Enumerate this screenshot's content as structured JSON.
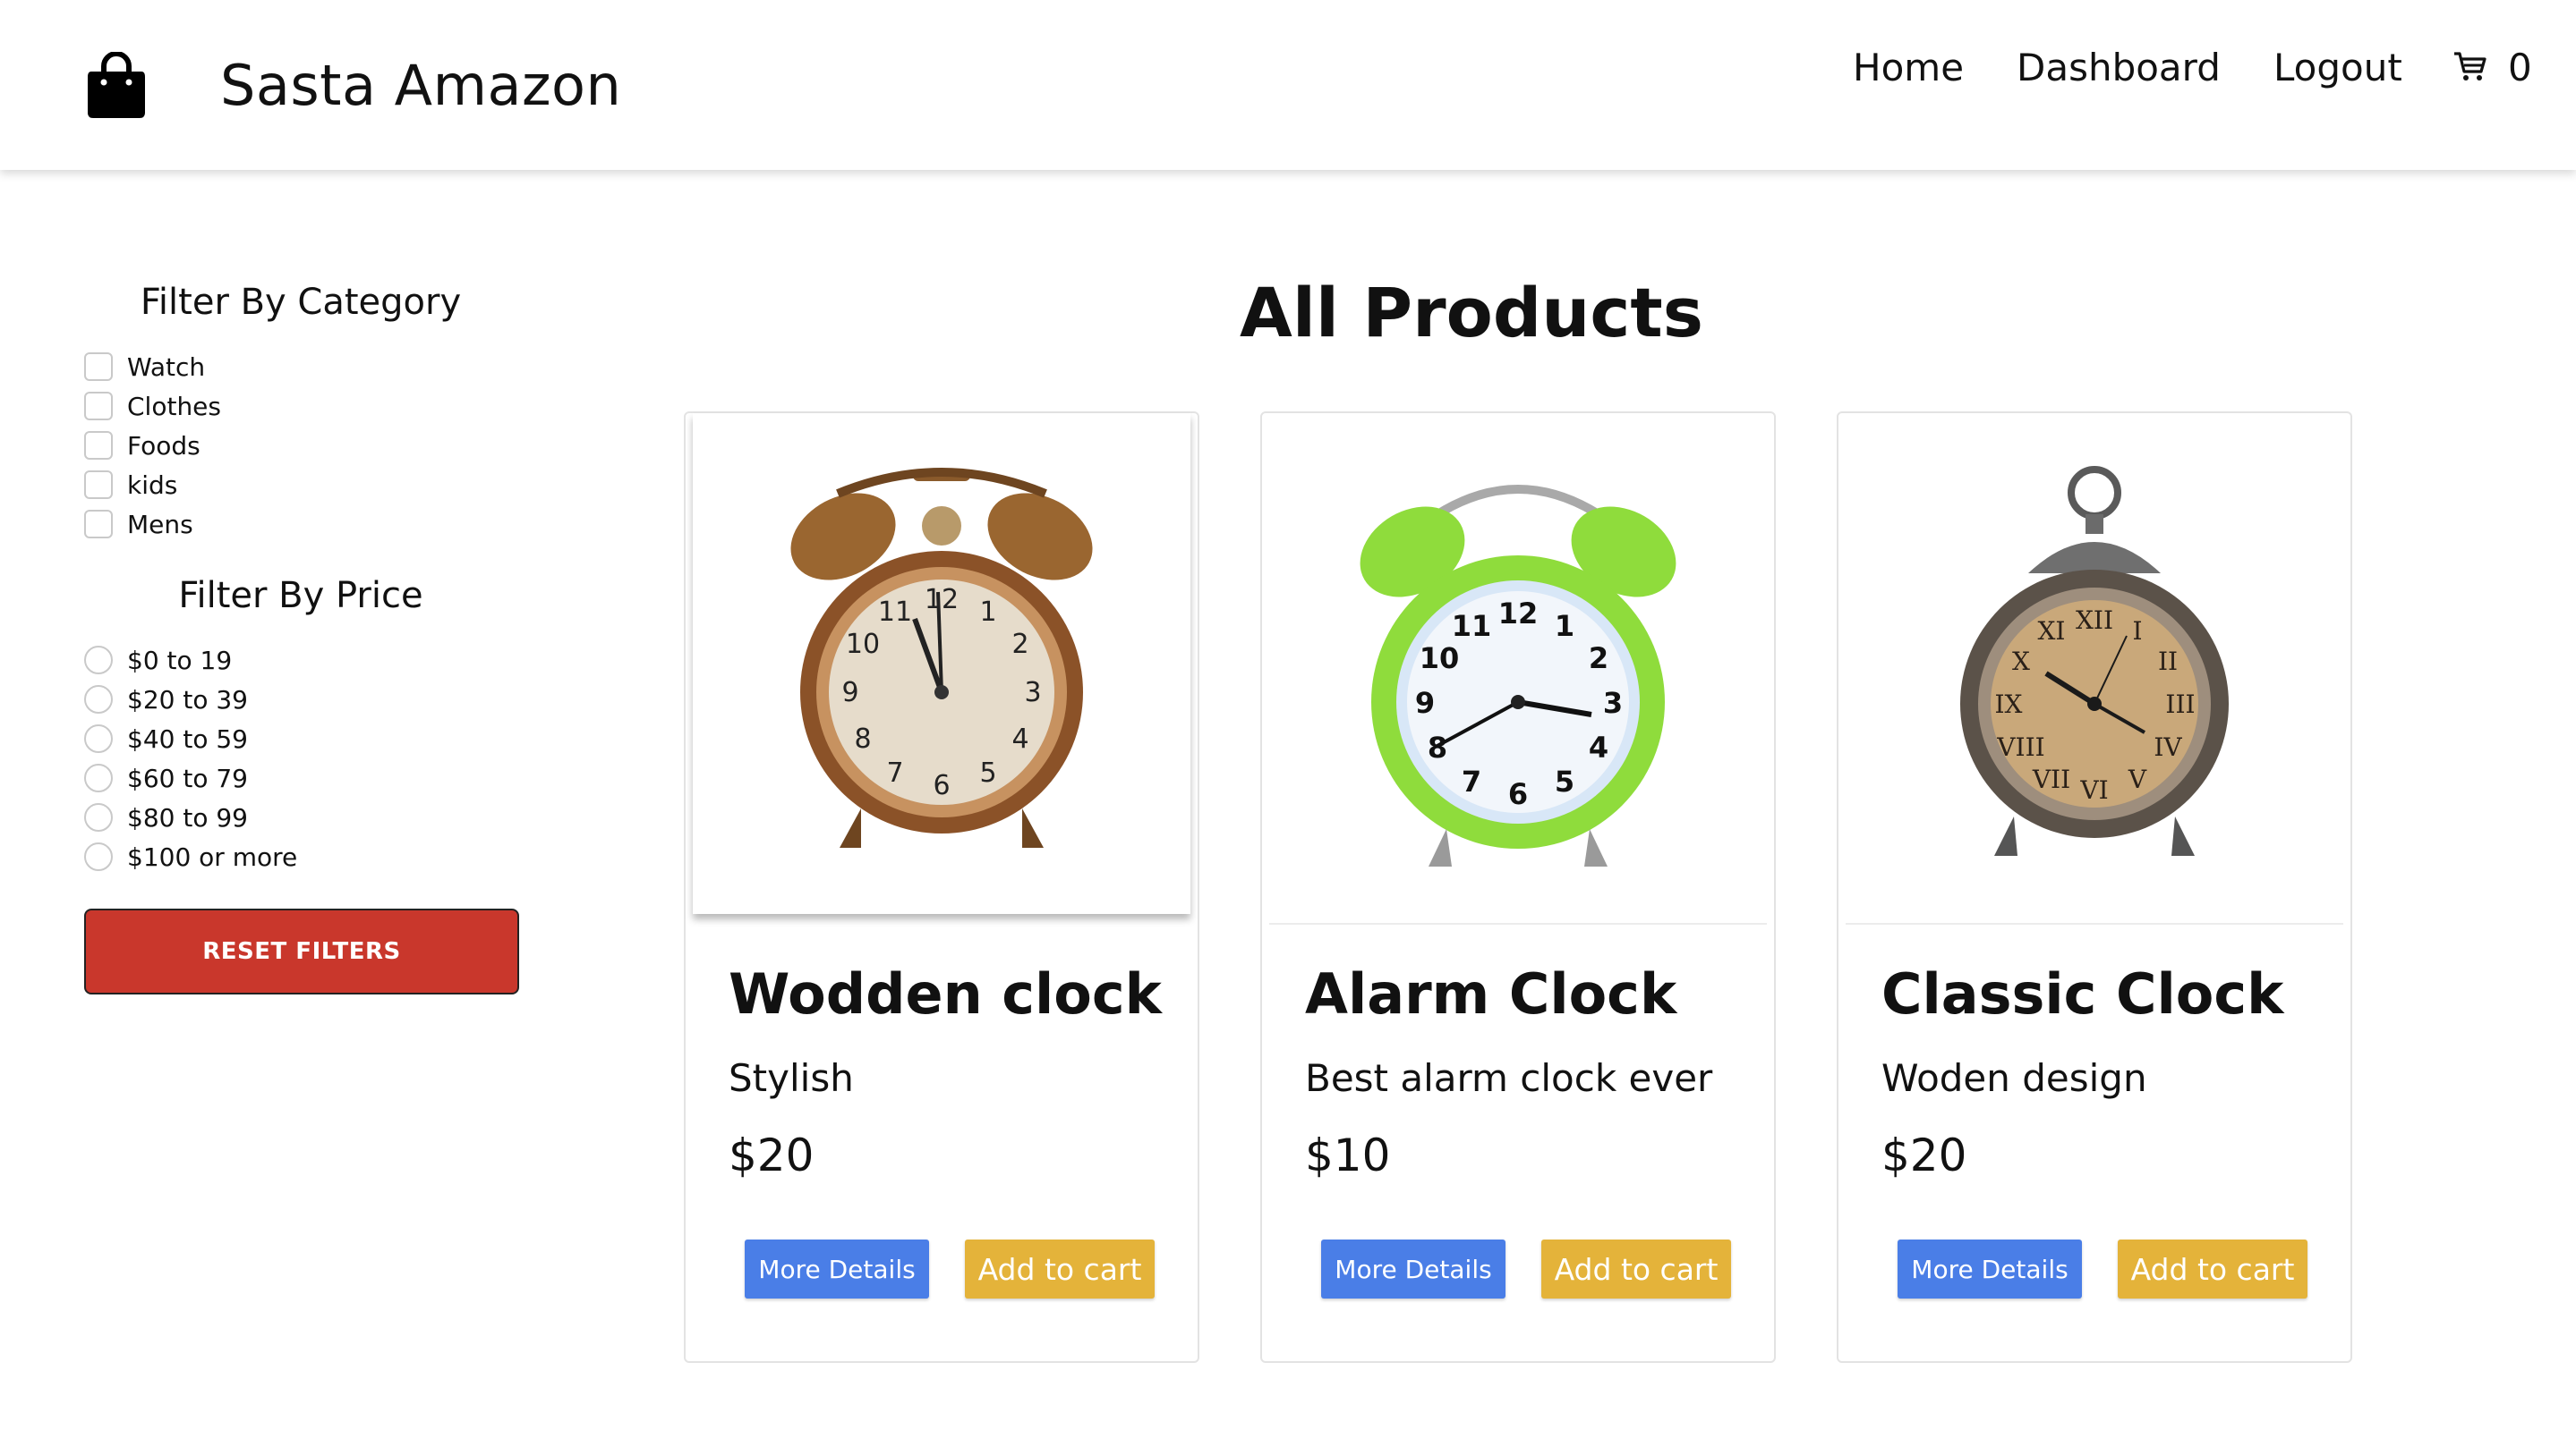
{
  "navbar": {
    "brand_icon": "shopping-bag-icon",
    "brand_name": "Sasta Amazon",
    "links": [
      "Home",
      "Dashboard",
      "Logout"
    ],
    "cart_icon": "cart-icon",
    "cart_count": "0"
  },
  "sidebar": {
    "category_title": "Filter By Category",
    "categories": [
      "Watch",
      "Clothes",
      "Foods",
      "kids",
      "Mens"
    ],
    "price_title": "Filter By Price",
    "prices": [
      "$0 to 19",
      "$20 to 39",
      "$40 to 59",
      "$60 to 79",
      "$80 to 99",
      "$100 or more"
    ],
    "reset_label": "RESET FILTERS"
  },
  "main": {
    "title": "All Products",
    "products": [
      {
        "name": "Wodden clock",
        "description": "Stylish",
        "price": "$20",
        "image": "wooden-alarm-clock-image"
      },
      {
        "name": "Alarm Clock",
        "description": "Best alarm clock ever",
        "price": "$10",
        "image": "green-alarm-clock-image"
      },
      {
        "name": "Classic Clock",
        "description": "Woden design",
        "price": "$20",
        "image": "classic-pocket-clock-image"
      }
    ],
    "details_label": "More Details",
    "cart_label": "Add to cart"
  },
  "colors": {
    "reset_button": "#c9372c",
    "details_button": "#4a7ee7",
    "cart_button": "#e4b33a"
  }
}
